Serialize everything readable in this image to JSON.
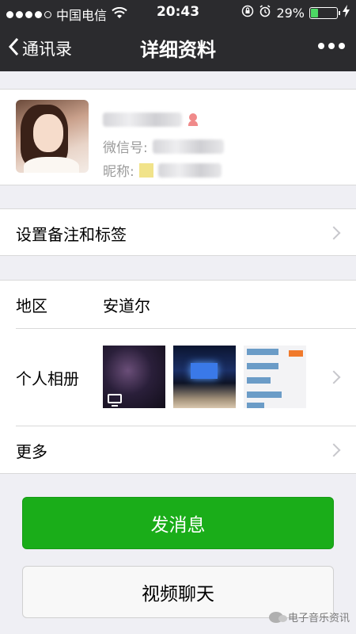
{
  "status_bar": {
    "carrier": "中国电信",
    "time": "20:43",
    "battery_percent": "29%",
    "battery_level": 0.29
  },
  "nav": {
    "back_label": "通讯录",
    "title": "详细资料"
  },
  "profile": {
    "wechat_id_label": "微信号:",
    "nickname_label": "昵称:"
  },
  "rows": {
    "remark_label": "设置备注和标签",
    "region_label": "地区",
    "region_value": "安道尔",
    "album_label": "个人相册",
    "more_label": "更多"
  },
  "buttons": {
    "send_message": "发消息",
    "video_chat": "视频聊天"
  },
  "watermark": "电子音乐资讯",
  "colors": {
    "nav_bg": "#2b2b2e",
    "primary_green": "#1aad19",
    "page_bg": "#efeff4"
  }
}
